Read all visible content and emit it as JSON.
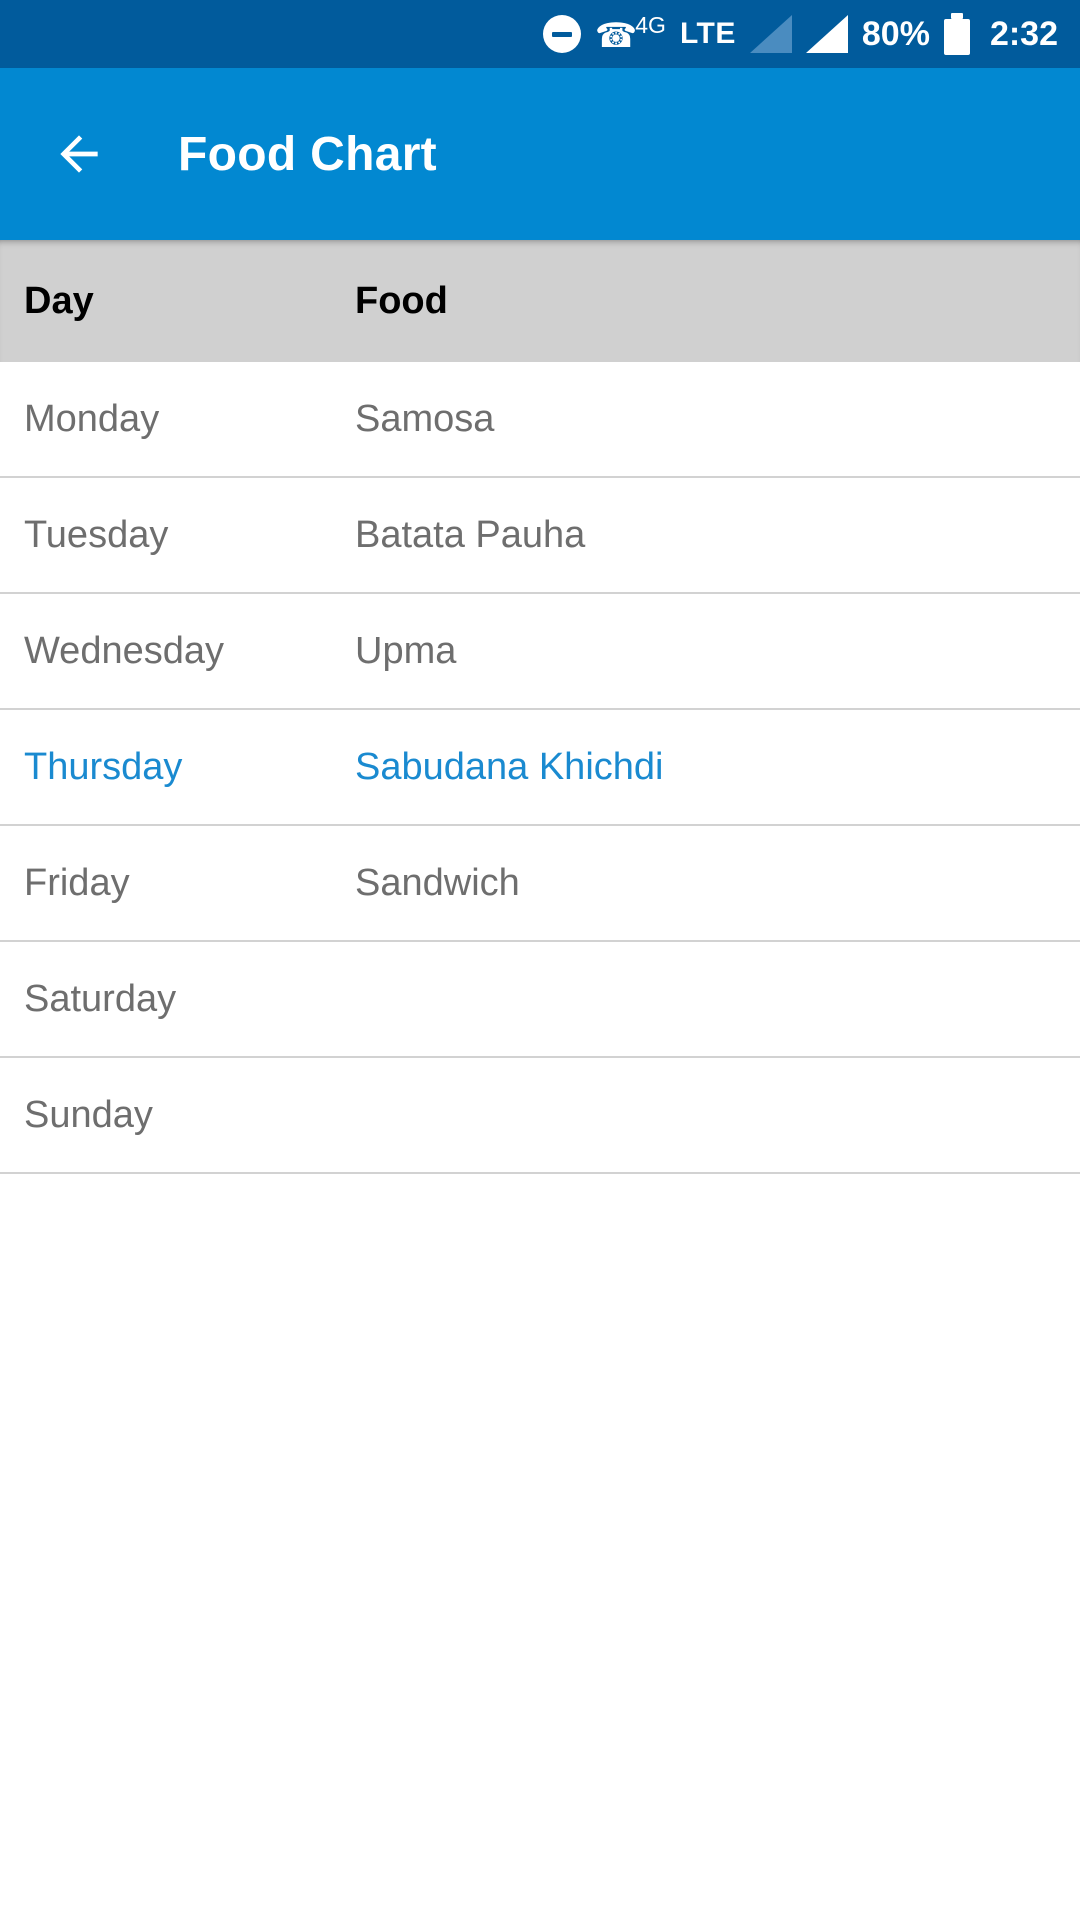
{
  "status_bar": {
    "dnd_icon": "do-not-disturb-icon",
    "network_type": "4G",
    "lte_label": "LTE",
    "signal_1": "signal-bars-inactive-icon",
    "signal_2": "signal-bars-active-icon",
    "battery_percent": "80%",
    "battery_icon": "battery-full-icon",
    "time": "2:32",
    "background_color": "#015B9C"
  },
  "app_bar": {
    "back_icon": "arrow-left-icon",
    "title": "Food Chart",
    "background_color": "#0288D1"
  },
  "table": {
    "header": {
      "day": "Day",
      "food": "Food",
      "background_color": "#d0d0d0"
    },
    "selected_color": "#1a8ad0",
    "text_color": "#6e6e6e",
    "rows": [
      {
        "day": "Monday",
        "food": "Samosa",
        "selected": false
      },
      {
        "day": "Tuesday",
        "food": "Batata Pauha",
        "selected": false
      },
      {
        "day": "Wednesday",
        "food": "Upma",
        "selected": false
      },
      {
        "day": "Thursday",
        "food": "Sabudana Khichdi",
        "selected": true
      },
      {
        "day": "Friday",
        "food": "Sandwich",
        "selected": false
      },
      {
        "day": "Saturday",
        "food": "",
        "selected": false
      },
      {
        "day": "Sunday",
        "food": "",
        "selected": false
      }
    ]
  }
}
